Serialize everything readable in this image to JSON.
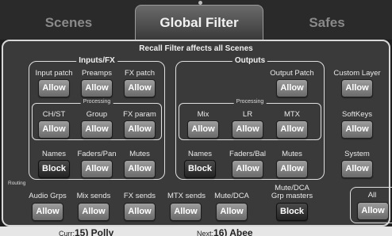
{
  "tabs": {
    "scenes": "Scenes",
    "global_filter": "Global Filter",
    "safes": "Safes"
  },
  "notice": "Recall Filter affects all Scenes",
  "inputs_fx": {
    "title": "Inputs/FX",
    "processing_title": "Processing",
    "row1": [
      {
        "label": "Input patch",
        "button": "Allow"
      },
      {
        "label": "Preamps",
        "button": "Allow"
      },
      {
        "label": "FX patch",
        "button": "Allow"
      }
    ],
    "row2": [
      {
        "label": "CH/ST",
        "button": "Allow"
      },
      {
        "label": "Group",
        "button": "Allow"
      },
      {
        "label": "FX param",
        "button": "Allow"
      }
    ],
    "row3": [
      {
        "label": "Names",
        "button": "Block"
      },
      {
        "label": "Faders/Pan",
        "button": "Allow"
      },
      {
        "label": "Mutes",
        "button": "Allow"
      }
    ]
  },
  "outputs": {
    "title": "Outputs",
    "processing_title": "Processing",
    "output_patch": {
      "label": "Output Patch",
      "button": "Allow"
    },
    "row2": [
      {
        "label": "Mix",
        "button": "Allow"
      },
      {
        "label": "LR",
        "button": "Allow"
      },
      {
        "label": "MTX",
        "button": "Allow"
      }
    ],
    "row3": [
      {
        "label": "Names",
        "button": "Block"
      },
      {
        "label": "Faders/Bal",
        "button": "Allow"
      },
      {
        "label": "Mutes",
        "button": "Allow"
      }
    ]
  },
  "side": [
    {
      "label": "Custom Layer",
      "button": "Allow"
    },
    {
      "label": "SoftKeys",
      "button": "Allow"
    },
    {
      "label": "System",
      "button": "Allow"
    }
  ],
  "routing": {
    "title": "Routing",
    "items": [
      {
        "label": "Audio Grps",
        "button": "Allow"
      },
      {
        "label": "Mix sends",
        "button": "Allow"
      },
      {
        "label": "FX sends",
        "button": "Allow"
      },
      {
        "label": "MTX sends",
        "button": "Allow"
      },
      {
        "label": "Mute/DCA",
        "button": "Allow"
      }
    ],
    "grp_masters": {
      "label_line1": "Mute/DCA",
      "label_line2": "Grp masters",
      "button": "Block"
    }
  },
  "all": {
    "label": "All",
    "button": "Allow"
  },
  "footer": {
    "curr_prefix": "Curr:",
    "curr_value": "15) Polly",
    "next_prefix": "Next:",
    "next_value": "16) Abee"
  }
}
